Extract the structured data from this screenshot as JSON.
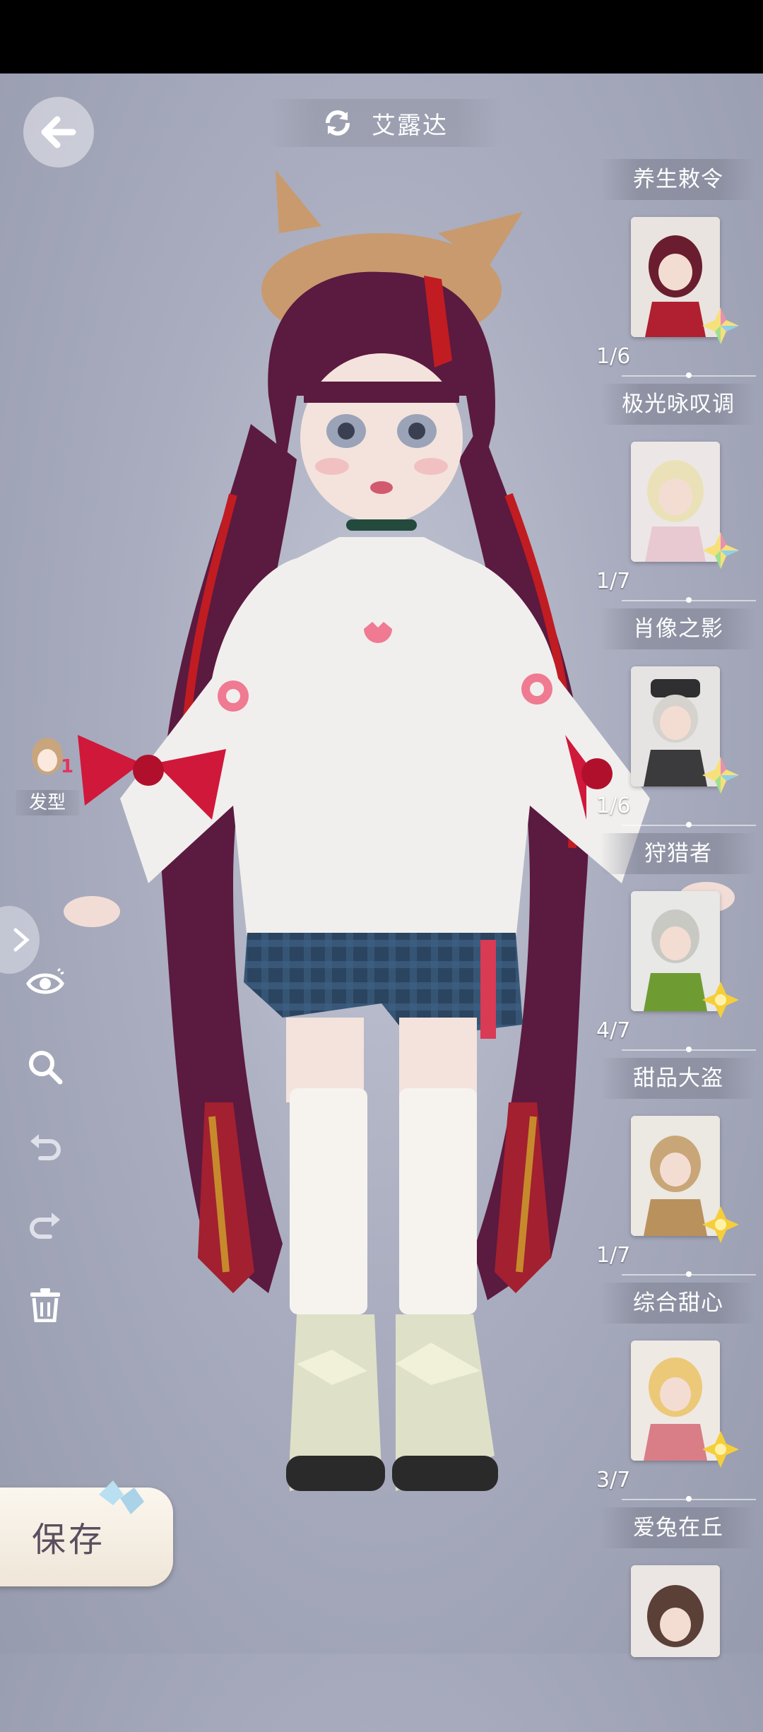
{
  "header": {
    "character_name": "艾露达",
    "back_icon": "back-arrow-icon",
    "switch_icon": "swap-arrows-icon"
  },
  "collections": [
    {
      "title": "养生敕令",
      "progress": "1/6",
      "gem": "multicolor",
      "theme": "#b02030"
    },
    {
      "title": "极光咏叹调",
      "progress": "1/7",
      "gem": "multicolor",
      "theme": "#e8c9d2"
    },
    {
      "title": "肖像之影",
      "progress": "1/6",
      "gem": "multicolor",
      "theme": "#3b3a3c"
    },
    {
      "title": "狩猎者",
      "progress": "4/7",
      "gem": "gold",
      "theme": "#6f9c32"
    },
    {
      "title": "甜品大盗",
      "progress": "1/7",
      "gem": "gold",
      "theme": "#b9915d"
    },
    {
      "title": "综合甜心",
      "progress": "3/7",
      "gem": "gold",
      "theme": "#d97d87"
    },
    {
      "title": "爱兔在丘",
      "progress": "",
      "gem": "",
      "theme": "#5b4038"
    }
  ],
  "left_tools": {
    "hairstyle_label": "发型",
    "hairstyle_badge": "1",
    "icons": [
      "eye-icon",
      "zoom-icon",
      "undo-icon",
      "redo-icon",
      "trash-icon"
    ]
  },
  "save": {
    "label": "保存"
  },
  "colors": {
    "background": "#a9adbf",
    "hair": "#5a1a3c",
    "hair_highlight": "#c01c22",
    "sweater": "#f1efed",
    "bow": "#d0183a",
    "shorts": "#2f4a66"
  }
}
